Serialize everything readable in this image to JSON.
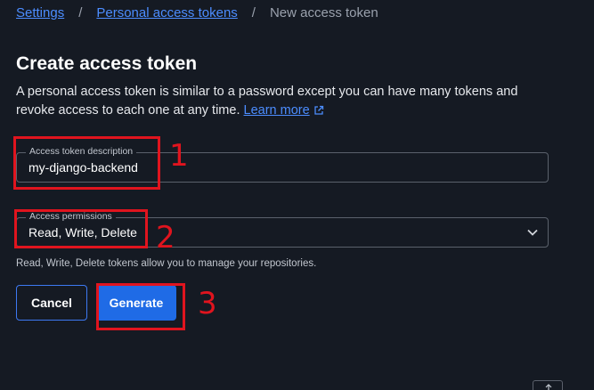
{
  "breadcrumb": {
    "items": [
      {
        "label": "Settings"
      },
      {
        "label": "Personal access tokens"
      }
    ],
    "separator": "/",
    "current": "New access token"
  },
  "page": {
    "title": "Create access token",
    "description": "A personal access token is similar to a password except you can have many tokens and revoke access to each one at any time.",
    "learn_more": "Learn more",
    "learn_more_icon": "external-link-icon"
  },
  "form": {
    "description_field": {
      "label": "Access token description",
      "value": "my-django-backend"
    },
    "permissions_field": {
      "label": "Access permissions",
      "value": "Read, Write, Delete",
      "icon": "chevron-down-icon"
    },
    "helper_text": "Read, Write, Delete tokens allow you to manage your repositories."
  },
  "actions": {
    "cancel_label": "Cancel",
    "generate_label": "Generate"
  },
  "annotations": {
    "labels": [
      "1",
      "2",
      "3"
    ],
    "color": "#e0141e"
  },
  "colors": {
    "background": "#151a23",
    "link": "#4c8dff",
    "primary": "#1f6be6"
  }
}
